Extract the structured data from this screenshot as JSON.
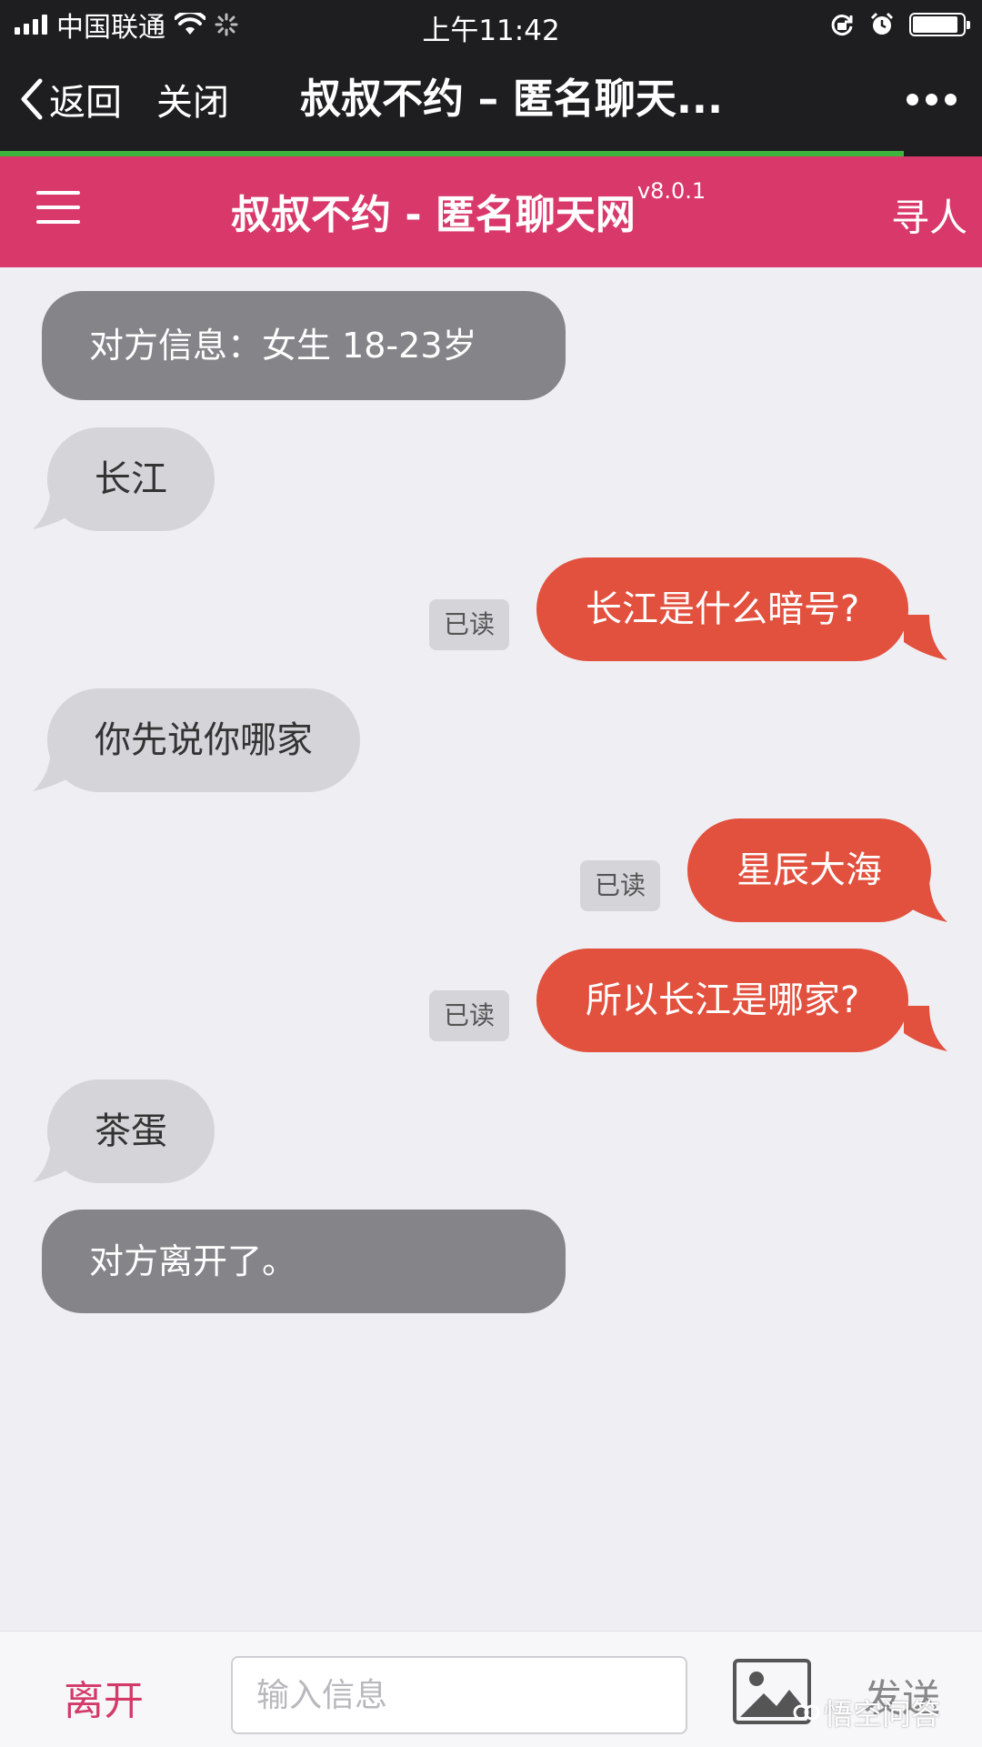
{
  "status_bar": {
    "carrier": "中国联通",
    "time": "上午11:42",
    "battery_level": 0.9
  },
  "webview": {
    "back_label": "返回",
    "close_label": "关闭",
    "title": "叔叔不约 – 匿名聊天...",
    "load_progress": 0.92
  },
  "app_header": {
    "title": "叔叔不约 - 匿名聊天网",
    "version": "v8.0.1",
    "find_label": "寻人"
  },
  "chat": {
    "system_info": "对方信息：女生 18-23岁",
    "messages": [
      {
        "from": "them",
        "text": "长江"
      },
      {
        "from": "me",
        "text": "长江是什么暗号?",
        "status": "已读"
      },
      {
        "from": "them",
        "text": "你先说你哪家"
      },
      {
        "from": "me",
        "text": "星辰大海",
        "status": "已读"
      },
      {
        "from": "me",
        "text": "所以长江是哪家?",
        "status": "已读"
      },
      {
        "from": "them",
        "text": "茶蛋"
      }
    ],
    "system_left": "对方离开了。"
  },
  "footer": {
    "leave_label": "离开",
    "input_placeholder": "输入信息",
    "input_value": "",
    "send_label": "发送",
    "watermark": "悟空问答"
  },
  "colors": {
    "status_bg": "#1E1E20",
    "header_pink": "#D9396A",
    "outgoing_bubble": "#E2503E",
    "incoming_bubble": "#D5D4D9",
    "system_bubble": "#858488",
    "progress_green": "#3FB43C",
    "chat_bg": "#EFEEF3"
  }
}
